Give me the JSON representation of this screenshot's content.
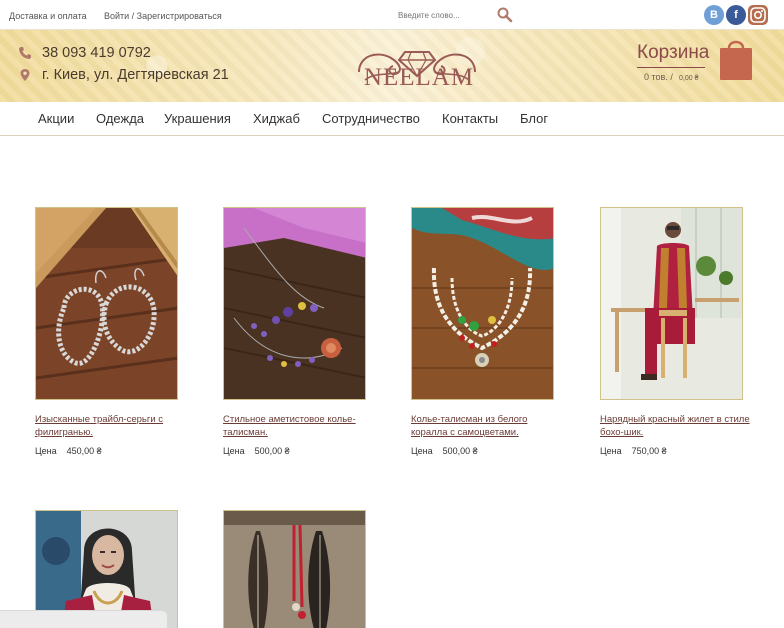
{
  "topbar": {
    "delivery": "Доставка и оплата",
    "login": "Войти / Зарегистрироваться",
    "search_placeholder": "Введите слово...",
    "social": [
      {
        "name": "vk",
        "label": "B"
      },
      {
        "name": "facebook",
        "label": "f"
      },
      {
        "name": "instagram",
        "label": ""
      }
    ]
  },
  "header": {
    "phone": "38 093 419 0792",
    "address": "г. Киев, ул. Дегтяревская 21",
    "logo": "NEELAM",
    "cart": {
      "title": "Корзина",
      "count": "0 тов. /",
      "sum": "0,00 ₴"
    }
  },
  "nav": [
    "Акции",
    "Одежда",
    "Украшения",
    "Хиджаб",
    "Сотрудничество",
    "Контакты",
    "Блог"
  ],
  "products": [
    {
      "title": "Изысканные трайбл-серьги с филигранью.",
      "price_label": "Цена",
      "price": "450,00 ₴"
    },
    {
      "title": "Стильное аметистовое колье-талисман.",
      "price_label": "Цена",
      "price": "500,00 ₴"
    },
    {
      "title": "Колье-талисман из белого коралла с самоцветами.",
      "price_label": "Цена",
      "price": "500,00 ₴"
    },
    {
      "title": "Нарядный красный жилет в стиле бохо-шик.",
      "price_label": "Цена",
      "price": "750,00 ₴"
    }
  ],
  "colors": {
    "accent": "#8b4a4a",
    "cart_bag": "#c5664f",
    "link": "#6b3c36",
    "band": "#f2dc9a"
  }
}
